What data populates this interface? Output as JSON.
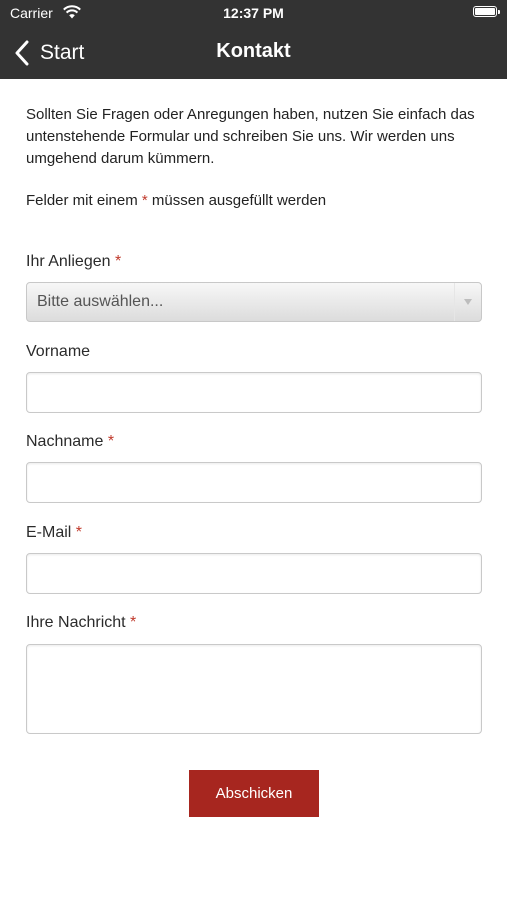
{
  "status_bar": {
    "carrier": "Carrier",
    "time": "12:37 PM"
  },
  "nav": {
    "back_label": "Start",
    "title": "Kontakt"
  },
  "intro_text": "Sollten Sie Fragen oder Anregungen haben, nutzen Sie einfach das untenstehende Formular und schreiben Sie uns. Wir werden uns umgehend darum kümmern.",
  "required_note": {
    "before": "Felder mit einem ",
    "star": "*",
    "after": " müssen ausgefüllt werden"
  },
  "form": {
    "anliegen": {
      "label": "Ihr Anliegen",
      "required_mark": "*",
      "selected": "Bitte auswählen..."
    },
    "vorname": {
      "label": "Vorname",
      "value": ""
    },
    "nachname": {
      "label": "Nachname",
      "required_mark": "*",
      "value": ""
    },
    "email": {
      "label": "E-Mail",
      "required_mark": "*",
      "value": ""
    },
    "nachricht": {
      "label": "Ihre Nachricht",
      "required_mark": "*",
      "value": ""
    },
    "submit_label": "Abschicken"
  },
  "colors": {
    "topbar": "#333333",
    "accent": "#a7261f",
    "required": "#c0392b"
  }
}
